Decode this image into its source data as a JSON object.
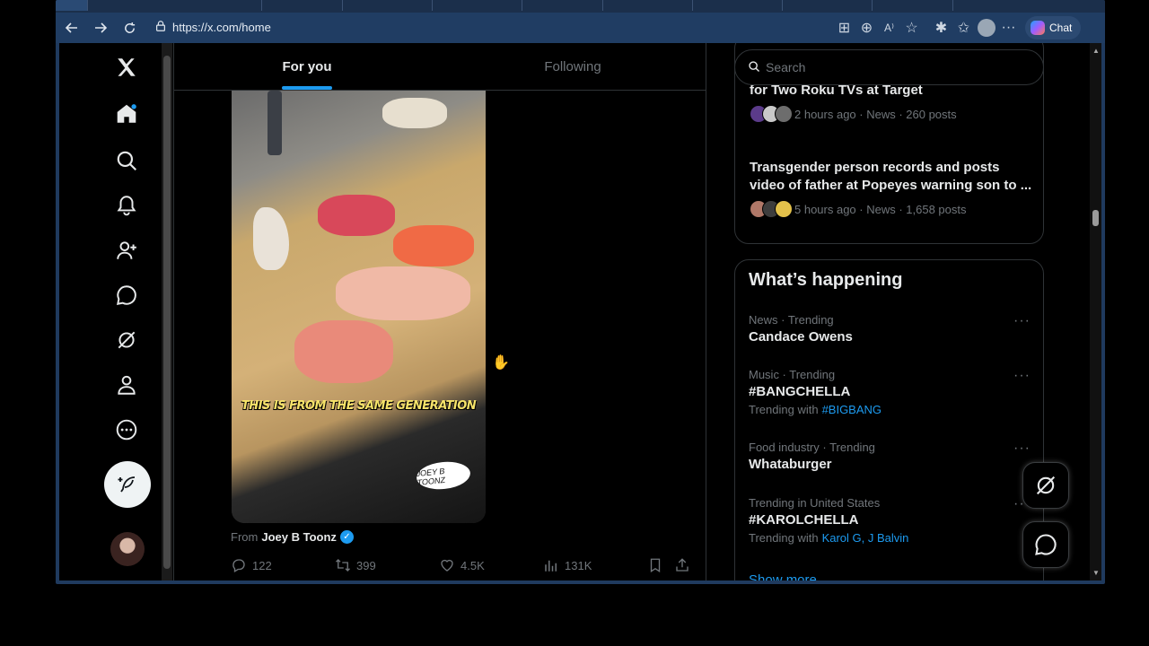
{
  "browser": {
    "url": "https://x.com/home",
    "chat_label": "Chat"
  },
  "feed": {
    "tabs": [
      {
        "label": "For you",
        "active": true
      },
      {
        "label": "Following",
        "active": false
      }
    ],
    "post": {
      "video_caption": "THIS IS FROM THE SAME GENERATION",
      "watermark": "JOEY B TOONZ",
      "from_label": "From",
      "from_name": "Joey B Toonz",
      "replies": "122",
      "reposts": "399",
      "likes": "4.5K",
      "views": "131K"
    }
  },
  "sidebar_right": {
    "search_placeholder": "Search",
    "news": [
      {
        "title": "Man Records Using Banana Picture to Pay for Two Roku TVs at Target",
        "meta": "2 hours ago · News · 260 posts"
      },
      {
        "title": "Transgender person records and posts video of father at Popeyes warning son to ...",
        "meta": "5 hours ago · News · 1,658 posts"
      }
    ],
    "whats_happening": {
      "title": "What’s happening",
      "trends": [
        {
          "context": "News · Trending",
          "name": "Candace Owens",
          "with_label": "",
          "with_links": ""
        },
        {
          "context": "Music · Trending",
          "name": "#BANGCHELLA",
          "with_label": "Trending with",
          "with_links": "#BIGBANG"
        },
        {
          "context": "Food industry · Trending",
          "name": "Whataburger",
          "with_label": "",
          "with_links": ""
        },
        {
          "context": "Trending in United States",
          "name": "#KAROLCHELLA",
          "with_label": "Trending with",
          "with_links": "Karol G, J Balvin"
        }
      ],
      "show_more": "Show more"
    }
  },
  "colors": {
    "accent": "#1d9bf0",
    "background": "#000000",
    "browser_chrome": "#203d63"
  }
}
